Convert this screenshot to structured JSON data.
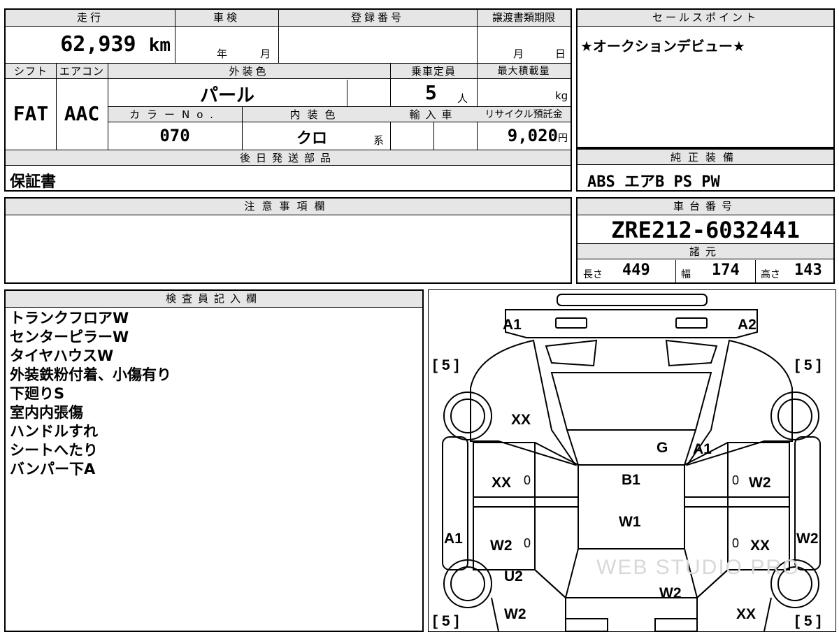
{
  "mileage": {
    "label": "走行",
    "value": "62,939",
    "unit": "km"
  },
  "inspection": {
    "label": "車検",
    "year_unit": "年",
    "month_unit": "月"
  },
  "registration": {
    "label": "登録番号",
    "value": ""
  },
  "transfer_deadline": {
    "label": "譲渡書類期限",
    "month_unit": "月",
    "day_unit": "日"
  },
  "sales_point": {
    "label": "セールスポイント",
    "text": "★オークションデビュー★"
  },
  "shift": {
    "label": "シフト",
    "value": "FAT"
  },
  "aircon": {
    "label": "エアコン",
    "value": "AAC"
  },
  "exterior_color": {
    "label": "外装色",
    "value": "パール"
  },
  "capacity": {
    "label": "乗車定員",
    "value": "5",
    "unit": "人"
  },
  "max_load": {
    "label": "最大積載量",
    "unit": "kg"
  },
  "color_no": {
    "label": "カラーNo.",
    "value": "070"
  },
  "interior_color": {
    "label": "内装色",
    "value": "クロ",
    "suffix": "系"
  },
  "import": {
    "label": "輸入車"
  },
  "recycle": {
    "label": "リサイクル預託金",
    "value": "9,020",
    "unit": "円"
  },
  "later_parts": {
    "label": "後日発送部品",
    "value": "保証書"
  },
  "equipment": {
    "label": "純正装備",
    "value": "ABS エアB PS PW"
  },
  "notes": {
    "label": "注意事項欄",
    "value": ""
  },
  "chassis": {
    "label": "車台番号",
    "value": "ZRE212-6032441"
  },
  "specs": {
    "label": "諸元",
    "length_label": "長さ",
    "length": "449",
    "width_label": "幅",
    "width": "174",
    "height_label": "高さ",
    "height": "143"
  },
  "inspector": {
    "label": "検査員記入欄",
    "lines": [
      "トランクフロアW",
      "センターピラーW",
      "タイヤハウスW",
      "外装鉄粉付着、小傷有り",
      "下廻りS",
      "室内内張傷",
      "ハンドルすれ",
      "シートへたり",
      "バンパー下A"
    ]
  },
  "diagram": {
    "tire_front_left": "[ 5 ]",
    "tire_front_right": "[ 5 ]",
    "tire_rear_left": "[ 5 ]",
    "tire_rear_right": "[ 5 ]",
    "a1_front_left": "A1",
    "a2_front_right": "A2",
    "xx_fender_left": "XX",
    "g_windshield": "G",
    "a1_pillar_right": "A1",
    "xx_front_door_left": "XX",
    "b1_roof": "B1",
    "w2_front_door_right": "W2",
    "w1_roof": "W1",
    "a1_rocker_left": "A1",
    "w2_rear_door_left": "W2",
    "xx_rear_door_right": "XX",
    "w2_rocker_right": "W2",
    "u2_quarter_left": "U2",
    "w2_trunk": "W2",
    "w2_rear_left": "W2",
    "xx_rear_right": "XX",
    "zero_1": "0",
    "zero_2": "0",
    "zero_3": "0",
    "zero_4": "0",
    "watermark": "WEB STUDIO PRO"
  }
}
